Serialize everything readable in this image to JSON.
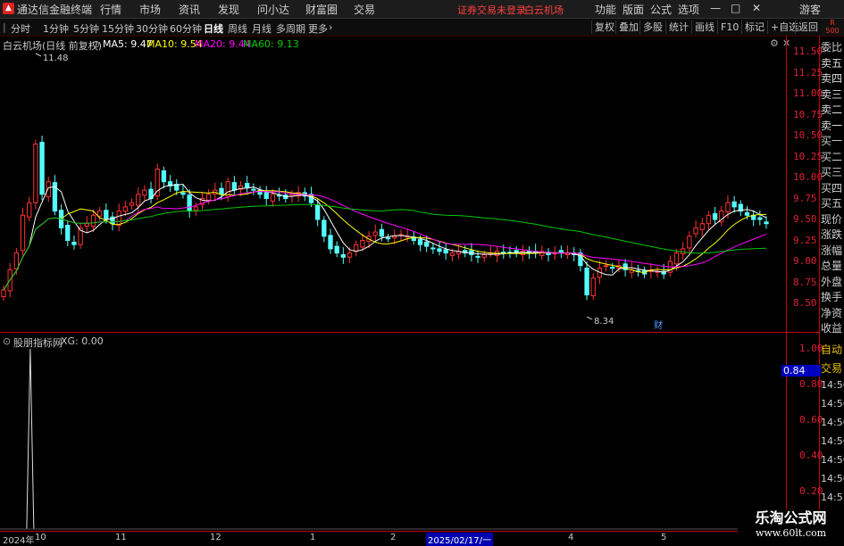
{
  "menubar": {
    "app_title": "通达信金融终端",
    "menus": [
      "行情",
      "市场",
      "资讯",
      "发现",
      "问小达",
      "财富圈",
      "交易"
    ],
    "notice": "证券交易未登录",
    "stock_name": "白云机场",
    "right_menus": [
      "功能",
      "版面",
      "公式",
      "选项"
    ],
    "guest": "游客"
  },
  "tabs": {
    "periods": [
      "分时",
      "1分钟",
      "5分钟",
      "15分钟",
      "30分钟",
      "60分钟",
      "日线",
      "周线",
      "月线",
      "多周期",
      "更多"
    ],
    "active": "日线",
    "right_buttons": [
      "复权",
      "叠加",
      "多股",
      "统计",
      "画线",
      "F10",
      "标记",
      "+自选",
      "返回"
    ]
  },
  "info_line": {
    "title": "白云机场(日线 前复权)",
    "ma5": "MA5: 9.47",
    "ma10": "MA10: 9.54",
    "ma20": "MA20: 9.44",
    "ma60": "MA60: 9.13"
  },
  "indicator_line": {
    "title": "股朋指标网",
    "xg": "XG: 0.00"
  },
  "price_axis": [
    "11.50",
    "11.25",
    "11.00",
    "10.75",
    "10.50",
    "10.25",
    "10.00",
    "9.75",
    "9.50",
    "9.25",
    "9.00",
    "8.75",
    "8.50"
  ],
  "indicator_axis": [
    "1.00",
    "0.80",
    "0.60",
    "0.40",
    "0.20"
  ],
  "current_indicator_value": "0.84",
  "annotations": {
    "high": "11.48",
    "low": "8.34",
    "fin_marker": "财"
  },
  "right_side_labels": [
    "委比",
    "卖五",
    "卖四",
    "卖三",
    "卖二",
    "卖一",
    "买一",
    "买二",
    "买三",
    "买四",
    "买五",
    "现价",
    "涨跌",
    "涨幅",
    "总量",
    "外盘",
    "换手",
    "净资",
    "收益"
  ],
  "right_side_lower": [
    "自动",
    "交易",
    "14:56",
    "14:56",
    "14:56",
    "14:56",
    "14:56",
    "14:56",
    "14:5"
  ],
  "top_right_badge": [
    "R",
    "500"
  ],
  "date_axis": [
    "2024年",
    "10",
    "11",
    "12",
    "1",
    "2",
    "2025/02/17/一",
    "4",
    "5"
  ],
  "watermark": {
    "title": "乐淘公式网",
    "url": "www.60lt.com"
  },
  "colors": {
    "up": "#ff3232",
    "down": "#54ffff",
    "ma5": "#ffffff",
    "ma10": "#ffff00",
    "ma20": "#ff00ff",
    "ma60": "#00c800",
    "axis": "#c80000"
  },
  "chart_data": {
    "type": "candlestick",
    "title": "白云机场(日线 前复权)",
    "ylim": [
      8.3,
      11.6
    ],
    "series": [
      {
        "name": "MA5",
        "value": 9.47
      },
      {
        "name": "MA10",
        "value": 9.54
      },
      {
        "name": "MA20",
        "value": 9.44
      },
      {
        "name": "MA60",
        "value": 9.13
      }
    ],
    "closes": [
      8.66,
      8.9,
      9.1,
      9.55,
      9.7,
      10.4,
      9.8,
      9.95,
      9.6,
      9.4,
      9.25,
      9.2,
      9.4,
      9.45,
      9.55,
      9.6,
      9.5,
      9.45,
      9.6,
      9.65,
      9.7,
      9.8,
      9.85,
      9.75,
      10.1,
      9.95,
      9.9,
      9.85,
      9.8,
      9.6,
      9.65,
      9.75,
      9.8,
      9.85,
      9.8,
      9.95,
      9.85,
      9.9,
      9.88,
      9.85,
      9.8,
      9.75,
      9.8,
      9.78,
      9.75,
      9.8,
      9.82,
      9.78,
      9.7,
      9.5,
      9.3,
      9.15,
      9.1,
      9.05,
      9.1,
      9.2,
      9.25,
      9.3,
      9.35,
      9.3,
      9.28,
      9.3,
      9.32,
      9.3,
      9.25,
      9.2,
      9.18,
      9.15,
      9.12,
      9.1,
      9.1,
      9.12,
      9.1,
      9.08,
      9.05,
      9.08,
      9.1,
      9.12,
      9.1,
      9.1,
      9.1,
      9.12,
      9.1,
      9.1,
      9.12,
      9.08,
      9.1,
      9.1,
      9.1,
      9.08,
      8.95,
      8.6,
      8.8,
      8.92,
      8.95,
      8.92,
      8.95,
      8.9,
      8.9,
      8.88,
      8.85,
      8.9,
      8.88,
      8.85,
      9.0,
      9.1,
      9.15,
      9.3,
      9.4,
      9.45,
      9.55,
      9.5,
      9.6,
      9.7,
      9.65,
      9.6,
      9.55,
      9.5,
      9.5,
      9.45
    ],
    "indicator": {
      "name": "XG",
      "value": 0.0,
      "ylim": [
        0,
        1.0
      ],
      "spike_at_index": 5
    }
  }
}
